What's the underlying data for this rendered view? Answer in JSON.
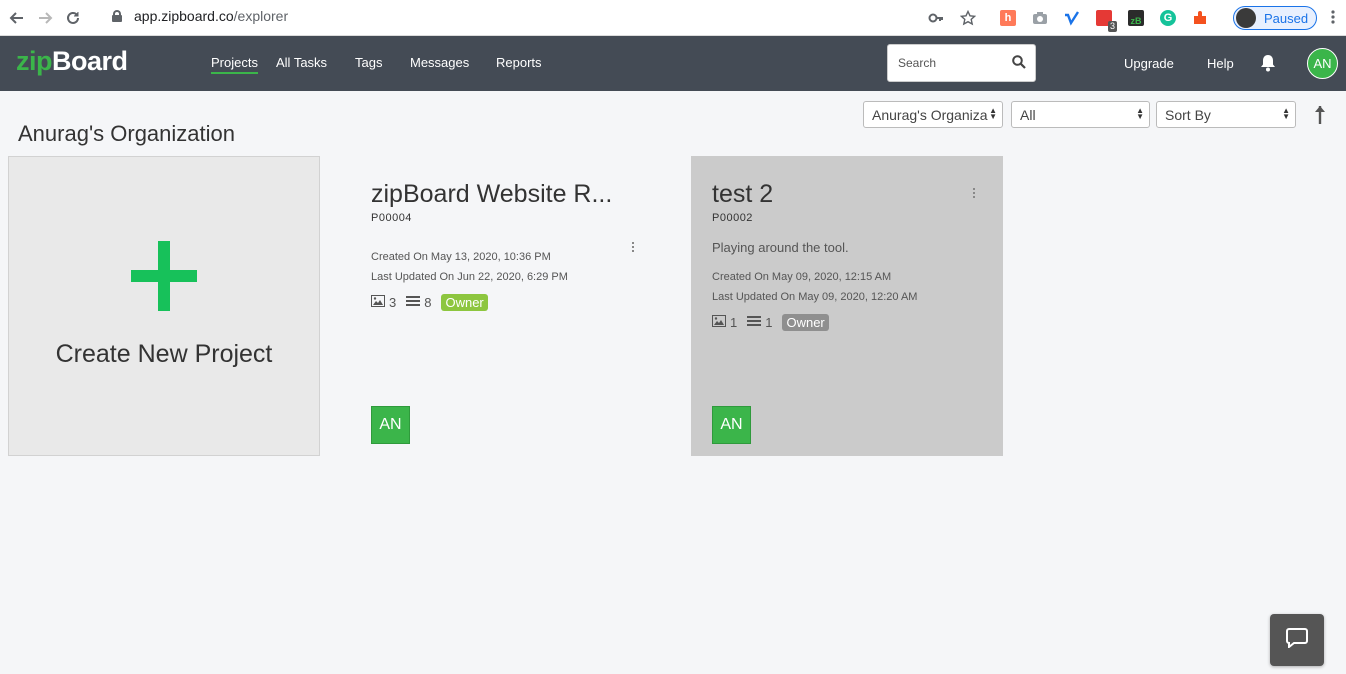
{
  "browser": {
    "url_host": "app.zipboard.co",
    "url_path": "/explorer",
    "profile_status": "Paused",
    "ext_badge_count": "3"
  },
  "header": {
    "logo_zip": "zip",
    "logo_board": "Board",
    "nav": [
      "Projects",
      "All Tasks",
      "Tags",
      "Messages",
      "Reports"
    ],
    "search_placeholder": "Search",
    "upgrade": "Upgrade",
    "help": "Help",
    "user_initials": "AN",
    "colors": {
      "bar": "#444b55",
      "accent": "#3bb54a"
    }
  },
  "toolbar": {
    "org_title": "Anurag's Organization",
    "org_select": "Anurag's Organiza",
    "filter_select": "All",
    "sort_select": "Sort By"
  },
  "create_card": {
    "label": "Create New Project"
  },
  "projects": [
    {
      "title": "zipBoard Website R...",
      "id": "P00004",
      "description": "",
      "created": "Created On May 13, 2020, 10:36 PM",
      "updated": "Last Updated On Jun 22, 2020, 6:29 PM",
      "images": "3",
      "tasks": "8",
      "role": "Owner",
      "member_initials": "AN"
    },
    {
      "title": "test 2",
      "id": "P00002",
      "description": "Playing around the tool.",
      "created": "Created On May 09, 2020, 12:15 AM",
      "updated": "Last Updated On May 09, 2020, 12:20 AM",
      "images": "1",
      "tasks": "1",
      "role": "Owner",
      "member_initials": "AN"
    }
  ]
}
